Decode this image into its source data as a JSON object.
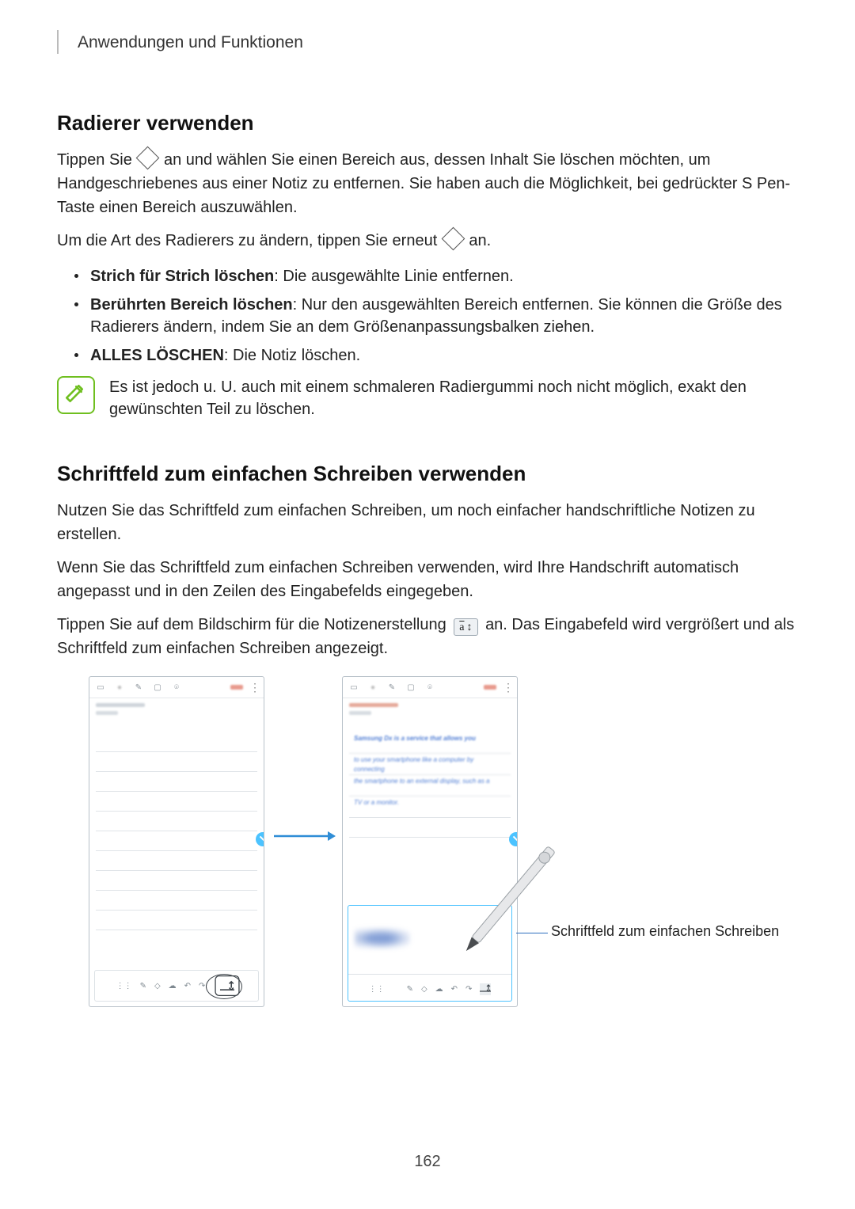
{
  "header": {
    "chapter": "Anwendungen und Funktionen"
  },
  "section1": {
    "heading": "Radierer verwenden",
    "p1a": "Tippen Sie ",
    "p1b": " an und wählen Sie einen Bereich aus, dessen Inhalt Sie löschen möchten, um Handgeschriebenes aus einer Notiz zu entfernen. Sie haben auch die Möglichkeit, bei gedrückter S Pen-Taste einen Bereich auszuwählen.",
    "p2a": "Um die Art des Radierers zu ändern, tippen Sie erneut ",
    "p2b": " an.",
    "b1_strong": "Strich für Strich löschen",
    "b1_rest": ": Die ausgewählte Linie entfernen.",
    "b2_strong": "Berührten Bereich löschen",
    "b2_rest": ": Nur den ausgewählten Bereich entfernen. Sie können die Größe des Radierers ändern, indem Sie an dem Größenanpassungsbalken ziehen.",
    "b3_strong": "ALLES LÖSCHEN",
    "b3_rest": ": Die Notiz löschen.",
    "note": "Es ist jedoch u. U. auch mit einem schmaleren Radiergummi noch nicht möglich, exakt den gewünschten Teil zu löschen."
  },
  "section2": {
    "heading": "Schriftfeld zum einfachen Schreiben verwenden",
    "p1": "Nutzen Sie das Schriftfeld zum einfachen Schreiben, um noch einfacher handschriftliche Notizen zu erstellen.",
    "p2": "Wenn Sie das Schriftfeld zum einfachen Schreiben verwenden, wird Ihre Handschrift automatisch angepasst und in den Zeilen des Eingabefelds eingegeben.",
    "p3a": "Tippen Sie auf dem Bildschirm für die Notizenerstellung ",
    "p3b": " an. Das Eingabefeld wird vergrößert und als Schriftfeld zum einfachen Schreiben angezeigt."
  },
  "figure": {
    "callout": "Schriftfeld zum einfachen Schreiben",
    "at_icon": {
      "a": "a",
      "arrows": "↕"
    }
  },
  "page_number": "162"
}
